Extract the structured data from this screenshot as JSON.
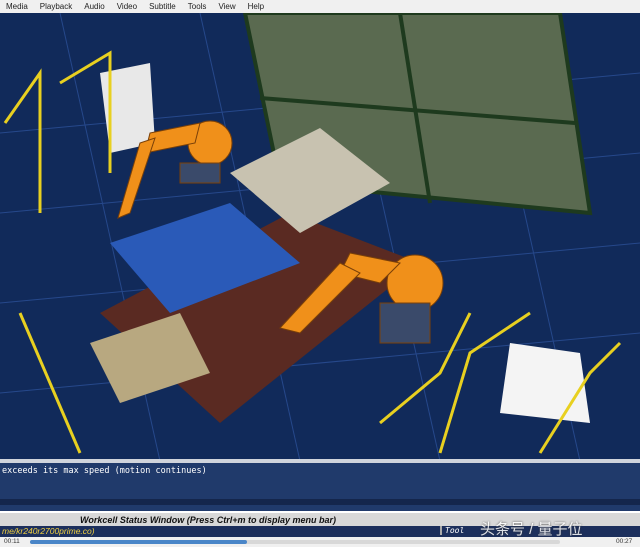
{
  "menu": [
    "Media",
    "Playback",
    "Audio",
    "Video",
    "Subtitle",
    "Tools",
    "View",
    "Help"
  ],
  "video": {
    "message": "exceeds its max speed (motion continues)",
    "status_window_title": "Workcell Status Window  (Press Ctrl+m to display menu bar)",
    "path_text": "me/kr240r2700prime.co)",
    "tool_label": "Tool",
    "watermark": "头条号 / 量子位"
  },
  "player": {
    "elapsed": "00:11",
    "total": "00:27",
    "progress": 0.41
  },
  "colors": {
    "robot": "#f0901a",
    "floor": "#1c3a78",
    "fence": "#e8d020",
    "progress": "#4a86c8"
  }
}
